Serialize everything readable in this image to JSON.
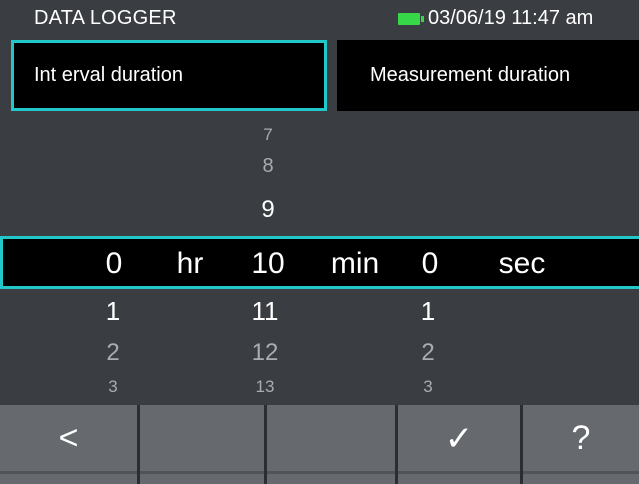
{
  "status": {
    "app_title": "DATA LOGGER",
    "datetime": "03/06/19 11:47 am",
    "battery_color": "#36d84a"
  },
  "tabs": [
    {
      "label": "Int erval duration",
      "active": true
    },
    {
      "label": "Measurement duration",
      "active": false
    }
  ],
  "accent_color": "#22c7c9",
  "picker": {
    "hours_above": [
      "",
      "",
      ""
    ],
    "minutes_above": [
      "7",
      "8",
      "9"
    ],
    "seconds_above": [
      "",
      "",
      ""
    ],
    "selected": {
      "hours": "0",
      "hours_unit": "hr",
      "minutes": "10",
      "minutes_unit": "min",
      "seconds": "0",
      "seconds_unit": "sec"
    },
    "hours_below": [
      "1",
      "2",
      "3"
    ],
    "minutes_below": [
      "11",
      "12",
      "13"
    ],
    "seconds_below": [
      "1",
      "2",
      "3"
    ]
  },
  "toolbar": {
    "back_icon": "chevron-left-icon",
    "back_glyph": "<",
    "confirm_icon": "check-icon",
    "confirm_glyph": "✓",
    "help_icon": "question-icon",
    "help_glyph": "?"
  }
}
